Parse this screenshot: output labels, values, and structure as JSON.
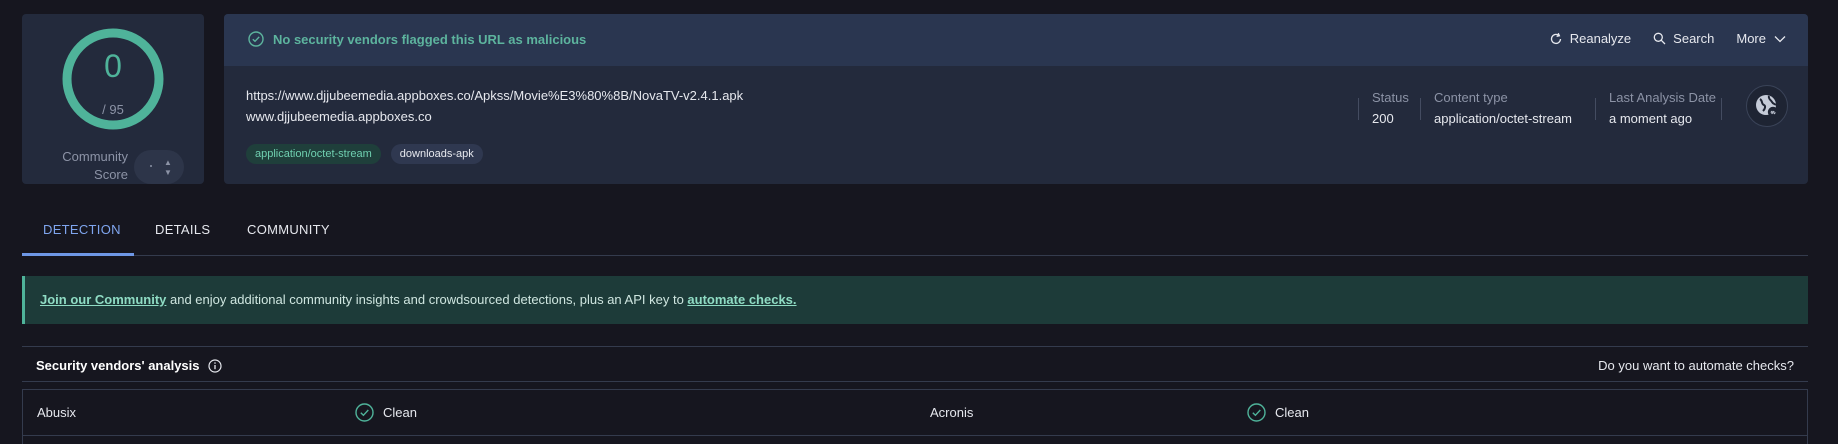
{
  "score": {
    "value": "0",
    "total": "/ 95",
    "community_label": "Community Score",
    "ring_color": "#4fb39a"
  },
  "banner": {
    "status_text": "No security vendors flagged this URL as malicious",
    "actions": {
      "reanalyze": "Reanalyze",
      "search": "Search",
      "more": "More"
    }
  },
  "url": {
    "full": "https://www.djjubeemedia.appboxes.co/Apkss/Movie%E3%80%8B/NovaTV-v2.4.1.apk",
    "domain": "www.djjubeemedia.appboxes.co"
  },
  "tags": [
    "application/octet-stream",
    "downloads-apk"
  ],
  "meta": {
    "status": {
      "label": "Status",
      "value": "200"
    },
    "content_type": {
      "label": "Content type",
      "value": "application/octet-stream"
    },
    "last_analysis": {
      "label": "Last Analysis Date",
      "value": "a moment ago"
    }
  },
  "tabs": [
    "DETECTION",
    "DETAILS",
    "COMMUNITY"
  ],
  "info_banner": {
    "join_link": "Join our Community",
    "middle_text": " and enjoy additional community insights and crowdsourced detections, plus an API key to ",
    "automate_link": "automate checks."
  },
  "vendors": {
    "title": "Security vendors' analysis",
    "automate_question": "Do you want to automate checks?",
    "rows": [
      {
        "left_name": "Abusix",
        "left_result": "Clean",
        "right_name": "Acronis",
        "right_result": "Clean"
      }
    ]
  },
  "colors": {
    "accent_green": "#4fb39a",
    "tab_active": "#7fa5ee",
    "background": "#16161f"
  }
}
